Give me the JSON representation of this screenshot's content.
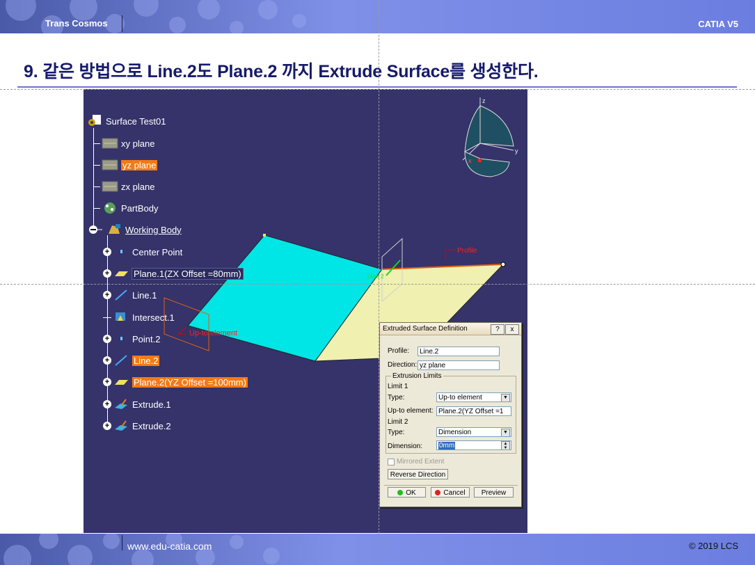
{
  "header": {
    "brand": "Trans Cosmos",
    "product": "CATIA V5"
  },
  "slide": {
    "title": "9. 같은 방법으로 Line.2도 Plane.2 까지 Extrude Surface를 생성한다."
  },
  "tree": {
    "root": "Surface Test01",
    "items": [
      {
        "label": "xy plane",
        "icon": "plane-icon"
      },
      {
        "label": "yz plane",
        "icon": "plane-icon"
      },
      {
        "label": "zx plane",
        "icon": "plane-icon"
      },
      {
        "label": "PartBody",
        "icon": "partbody-icon"
      },
      {
        "label": "Working Body",
        "icon": "body-icon"
      }
    ],
    "children": [
      {
        "label": "Center Point",
        "icon": "point-icon"
      },
      {
        "label": "Plane.1(ZX Offset =80mm)",
        "icon": "plane-icon"
      },
      {
        "label": "Line.1",
        "icon": "line-icon"
      },
      {
        "label": "Intersect.1",
        "icon": "intersect-icon"
      },
      {
        "label": "Point.2",
        "icon": "point-icon"
      },
      {
        "label": "Line.2",
        "icon": "line-icon"
      },
      {
        "label": "Plane.2(YZ Offset =100mm)",
        "icon": "plane-icon"
      },
      {
        "label": "Extrude.1",
        "icon": "extrude-icon"
      },
      {
        "label": "Extrude.2",
        "icon": "extrude-icon"
      }
    ]
  },
  "viewport": {
    "annotations": {
      "profile": "Profile",
      "up_to": "Up-to element",
      "limit2": "Limit 2"
    },
    "compass": {
      "x": "x",
      "y": "y",
      "z": "z"
    },
    "colors": {
      "background": "#35336a",
      "surface1": "#00e5e5",
      "surface2": "#f0f0b0",
      "selection": "#f27b15"
    }
  },
  "dialog": {
    "title": "Extruded Surface Definition",
    "help": "?",
    "close": "x",
    "profile_label": "Profile:",
    "profile_value": "Line.2",
    "direction_label": "Direction:",
    "direction_value": "yz plane",
    "extrusion_limits": "Extrusion Limits",
    "limit1": "Limit 1",
    "limit1_type_label": "Type:",
    "limit1_type_value": "Up-to element",
    "upto_label": "Up-to element:",
    "upto_value": "Plane.2(YZ Offset =1",
    "limit2": "Limit 2",
    "limit2_type_label": "Type:",
    "limit2_type_value": "Dimension",
    "dimension_label": "Dimension:",
    "dimension_value": "0mm",
    "mirrored": "Mirrored Extent",
    "reverse": "Reverse Direction",
    "ok": "OK",
    "cancel": "Cancel",
    "preview": "Preview"
  },
  "footer": {
    "website": "www.edu-catia.com",
    "copyright": "© 2019 LCS"
  }
}
